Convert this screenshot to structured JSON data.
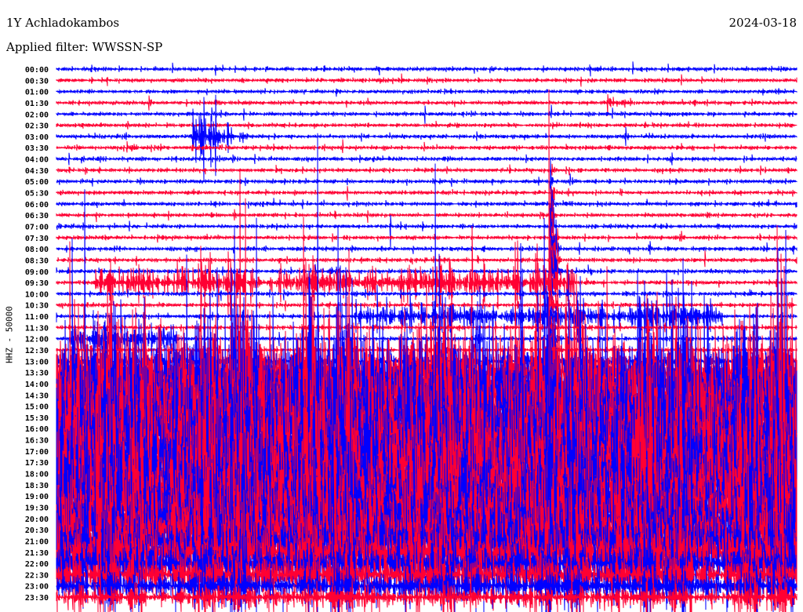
{
  "header": {
    "station": "1Y Achladokambos",
    "date": "2024-03-18",
    "filter": "Applied filter: WWSSN-SP"
  },
  "chart_data": {
    "type": "line",
    "title": "1Y Achladokambos",
    "subtitle": "Applied filter: WWSSN-SP",
    "ylabel": "HHZ - 50000",
    "xlabel": "",
    "row_minutes": 30,
    "colors": [
      "#0000ff",
      "#ff0033"
    ],
    "base_noise": 1.3,
    "rows": [
      {
        "label": "00:00",
        "events": [
          [
            21.8,
            30,
            1.8
          ]
        ]
      },
      {
        "label": "00:30",
        "events": [
          [
            15,
            16,
            3
          ]
        ]
      },
      {
        "label": "01:00",
        "events": []
      },
      {
        "label": "01:30",
        "events": [
          [
            22.3,
            24,
            6
          ]
        ]
      },
      {
        "label": "02:00",
        "events": []
      },
      {
        "label": "02:30",
        "events": []
      },
      {
        "label": "03:00",
        "events": [
          [
            5.5,
            8,
            25
          ]
        ]
      },
      {
        "label": "03:30",
        "events": [
          [
            2.8,
            3.6,
            8
          ]
        ]
      },
      {
        "label": "04:00",
        "events": []
      },
      {
        "label": "04:30",
        "events": [
          [
            20,
            20.2,
            15
          ]
        ]
      },
      {
        "label": "05:00",
        "events": [
          [
            20.8,
            21.5,
            5
          ],
          [
            20,
            20.2,
            15
          ]
        ]
      },
      {
        "label": "05:30",
        "events": [
          [
            20,
            20.3,
            25
          ]
        ]
      },
      {
        "label": "06:00",
        "events": [
          [
            20,
            20.3,
            20
          ]
        ]
      },
      {
        "label": "06:30",
        "events": [
          [
            20,
            20.3,
            20
          ]
        ]
      },
      {
        "label": "07:00",
        "events": [
          [
            13.5,
            13.6,
            10
          ],
          [
            20,
            20.3,
            30
          ]
        ]
      },
      {
        "label": "07:30",
        "events": [
          [
            20,
            20.5,
            40
          ]
        ]
      },
      {
        "label": "08:00",
        "events": [
          [
            15.5,
            30,
            1.6
          ],
          [
            20,
            20.5,
            40
          ],
          [
            24.7,
            25,
            5
          ]
        ]
      },
      {
        "label": "08:30",
        "events": [
          [
            20,
            20.5,
            30
          ],
          [
            17,
            17.2,
            8
          ],
          [
            9,
            9.2,
            6
          ]
        ]
      },
      {
        "label": "09:00",
        "events": [
          [
            20,
            20.5,
            30
          ],
          [
            11,
            12,
            8
          ]
        ]
      },
      {
        "label": "09:30",
        "events": [
          [
            1.5,
            21,
            14
          ],
          [
            20,
            20.5,
            30
          ]
        ]
      },
      {
        "label": "10:00",
        "events": [
          [
            20,
            20.5,
            20
          ]
        ]
      },
      {
        "label": "10:30",
        "events": [
          [
            20,
            20.5,
            25
          ],
          [
            13,
            13.2,
            8
          ],
          [
            6,
            6.3,
            6
          ]
        ]
      },
      {
        "label": "11:00",
        "events": [
          [
            12,
            27,
            12
          ],
          [
            0,
            0.5,
            4
          ],
          [
            20,
            20.5,
            25
          ]
        ]
      },
      {
        "label": "11:30",
        "events": [
          [
            20,
            20.5,
            25
          ],
          [
            13,
            13.3,
            6
          ]
        ]
      },
      {
        "label": "12:00",
        "events": [
          [
            0.5,
            5,
            12
          ],
          [
            17,
            17.5,
            8
          ],
          [
            20,
            20.5,
            25
          ]
        ]
      },
      {
        "label": "12:30",
        "events": [
          [
            20,
            20.5,
            25
          ]
        ]
      },
      {
        "label": "13:00",
        "events": [
          [
            0,
            30,
            6
          ],
          [
            19,
            19.5,
            15
          ]
        ]
      },
      {
        "label": "13:30",
        "events": [
          [
            0,
            30,
            40
          ]
        ]
      },
      {
        "label": "14:00",
        "events": [
          [
            0,
            30,
            55
          ]
        ]
      },
      {
        "label": "14:30",
        "events": [
          [
            0,
            30,
            60
          ]
        ]
      },
      {
        "label": "15:00",
        "events": [
          [
            0,
            30,
            60
          ]
        ]
      },
      {
        "label": "15:30",
        "events": [
          [
            0,
            30,
            60
          ]
        ]
      },
      {
        "label": "16:00",
        "events": [
          [
            0,
            30,
            60
          ]
        ]
      },
      {
        "label": "16:30",
        "events": [
          [
            0,
            30,
            60
          ]
        ]
      },
      {
        "label": "17:00",
        "events": [
          [
            0,
            30,
            60
          ]
        ]
      },
      {
        "label": "17:30",
        "events": [
          [
            0,
            30,
            60
          ]
        ]
      },
      {
        "label": "18:00",
        "events": [
          [
            0,
            30,
            60
          ]
        ]
      },
      {
        "label": "18:30",
        "events": [
          [
            0,
            30,
            60
          ]
        ]
      },
      {
        "label": "19:00",
        "events": [
          [
            0,
            30,
            55
          ]
        ]
      },
      {
        "label": "19:30",
        "events": [
          [
            0,
            30,
            55
          ]
        ]
      },
      {
        "label": "20:00",
        "events": [
          [
            0,
            30,
            50
          ]
        ]
      },
      {
        "label": "20:30",
        "events": [
          [
            0,
            30,
            45
          ]
        ]
      },
      {
        "label": "21:00",
        "events": [
          [
            0,
            30,
            40
          ]
        ]
      },
      {
        "label": "21:30",
        "events": [
          [
            0,
            30,
            35
          ]
        ]
      },
      {
        "label": "22:00",
        "events": [
          [
            0,
            30,
            25
          ]
        ]
      },
      {
        "label": "22:30",
        "events": [
          [
            0,
            30,
            20
          ]
        ]
      },
      {
        "label": "23:00",
        "events": [
          [
            0,
            30,
            15
          ]
        ]
      },
      {
        "label": "23:30",
        "events": [
          [
            0,
            30,
            10
          ],
          [
            8.8,
            9.3,
            6
          ]
        ]
      }
    ]
  }
}
